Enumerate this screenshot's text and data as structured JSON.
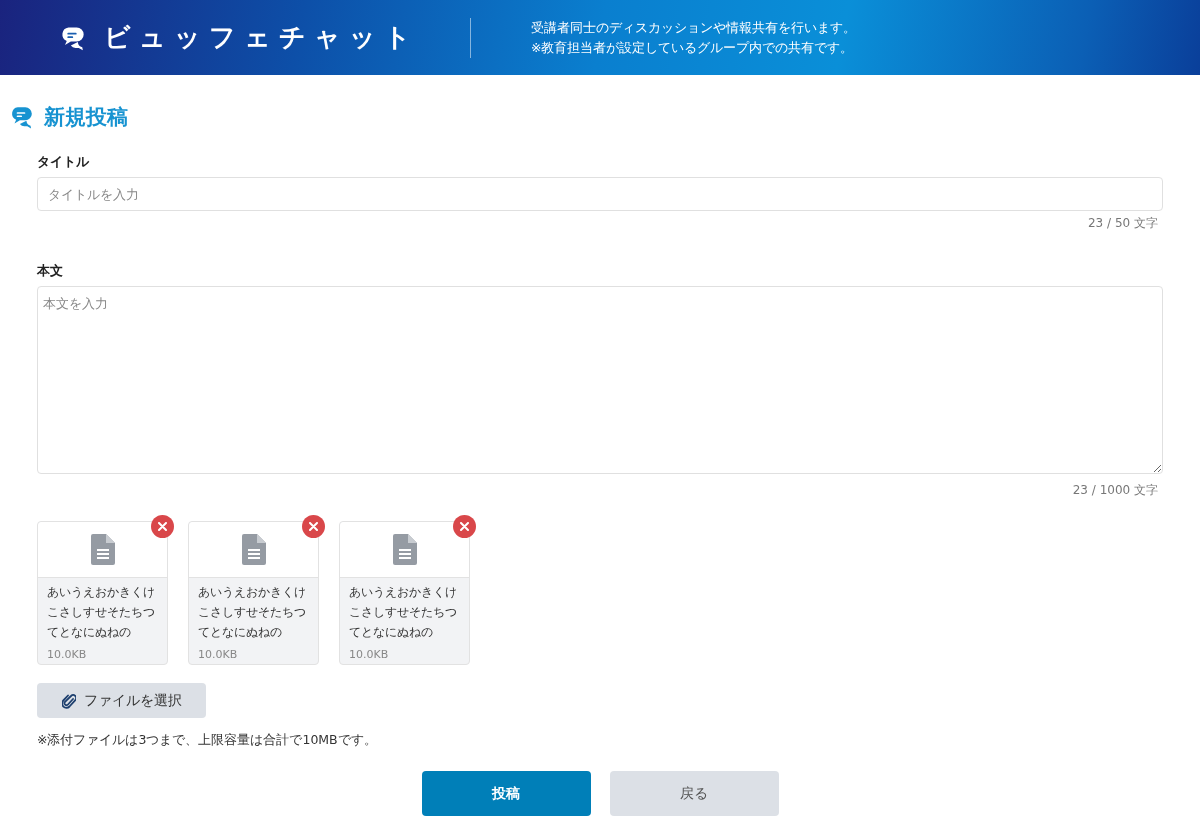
{
  "header": {
    "app_name": "ビュッフェチャット",
    "description_lines": [
      "受講者同士のディスカッションや情報共有を行います。",
      "※教育担当者が設定しているグループ内での共有です。"
    ]
  },
  "page_title": "新規投稿",
  "title_field": {
    "label": "タイトル",
    "placeholder": "タイトルを入力",
    "counter": "23 / 50 文字"
  },
  "body_field": {
    "label": "本文",
    "placeholder": "本文を入力",
    "counter": "23 / 1000 文字"
  },
  "attachments": [
    {
      "name": "あいうえおかきくけこさしすせそたちつてとなにぬねの",
      "size": "10.0KB"
    },
    {
      "name": "あいうえおかきくけこさしすせそたちつてとなにぬねの",
      "size": "10.0KB"
    },
    {
      "name": "あいうえおかきくけこさしすせそたちつてとなにぬねの",
      "size": "10.0KB"
    }
  ],
  "file_button": "ファイルを選択",
  "note": "※添付ファイルは3つまで、上限容量は合計で10MBです。",
  "buttons": [
    {
      "label": "投稿",
      "kind": "primary"
    },
    {
      "label": "戻る",
      "kind": "secondary"
    }
  ]
}
